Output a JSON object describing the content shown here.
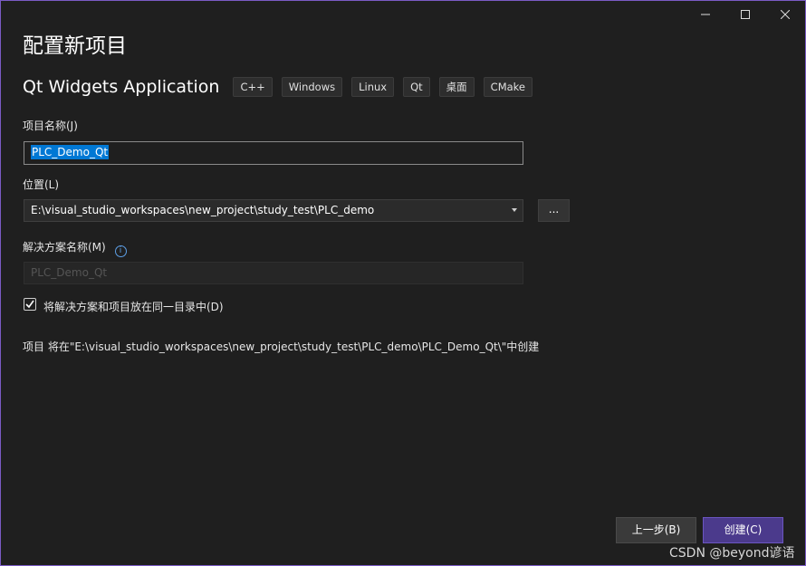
{
  "window": {
    "title": "配置新项目",
    "controls": [
      "minimize-icon",
      "maximize-icon",
      "close-icon"
    ]
  },
  "app": {
    "name": "Qt Widgets Application",
    "tags": [
      "C++",
      "Windows",
      "Linux",
      "Qt",
      "桌面",
      "CMake"
    ]
  },
  "project_name": {
    "label": "项目名称(J)",
    "value": "PLC_Demo_Qt"
  },
  "location": {
    "label": "位置(L)",
    "value": "E:\\visual_studio_workspaces\\new_project\\study_test\\PLC_demo",
    "browse_label": "..."
  },
  "solution_name": {
    "label": "解决方案名称(M)",
    "value": "PLC_Demo_Qt",
    "info_icon": "info-icon"
  },
  "same_dir": {
    "label": "将解决方案和项目放在同一目录中(D)",
    "checked": true
  },
  "summary": "项目 将在\"E:\\visual_studio_workspaces\\new_project\\study_test\\PLC_demo\\PLC_Demo_Qt\\\"中创建",
  "buttons": {
    "back": "上一步(B)",
    "create": "创建(C)"
  },
  "watermark": "CSDN @beyond谚语",
  "colors": {
    "background": "#1f1f1f",
    "accent": "#4b3a8c",
    "selection": "#0078d4",
    "border": "#7a5bc4"
  }
}
